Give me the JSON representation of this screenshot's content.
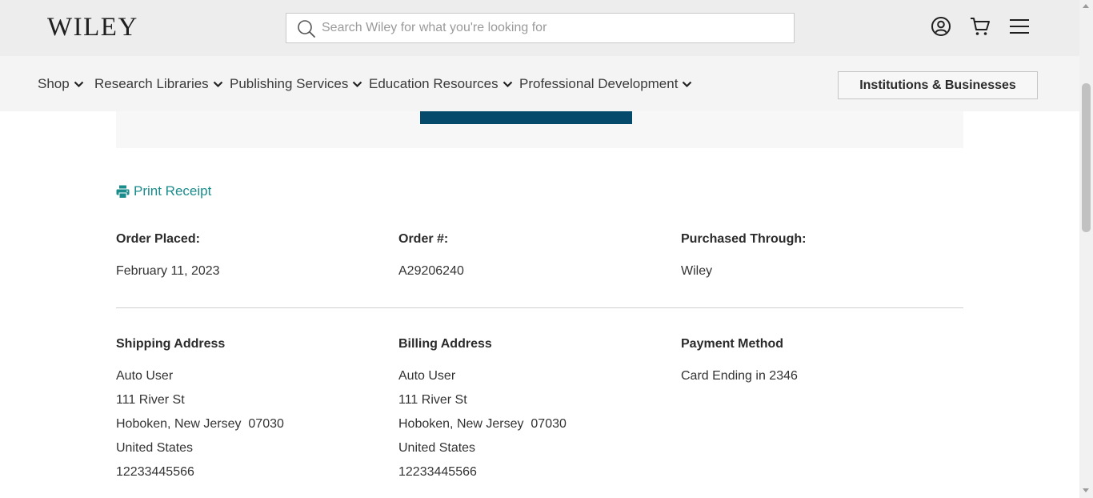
{
  "header": {
    "logo": "WILEY",
    "search_placeholder": "Search Wiley for what you're looking for",
    "icons": [
      "account-icon",
      "cart-icon",
      "menu-icon"
    ]
  },
  "nav": {
    "items": [
      {
        "label": "Shop"
      },
      {
        "label": "Research Libraries"
      },
      {
        "label": "Publishing Services"
      },
      {
        "label": "Education Resources"
      },
      {
        "label": "Professional Development"
      }
    ],
    "institutions_label": "Institutions & Businesses"
  },
  "order": {
    "print_label": "Print Receipt",
    "placed_label": "Order Placed:",
    "placed_value": "February 11, 2023",
    "number_label": "Order #:",
    "number_value": "A29206240",
    "through_label": "Purchased Through:",
    "through_value": "Wiley"
  },
  "shipping": {
    "label": "Shipping Address",
    "name": "Auto User",
    "street": "111 River St",
    "city_line": "Hoboken, New Jersey  07030",
    "country": "United States",
    "phone": "12233445566"
  },
  "billing": {
    "label": "Billing Address",
    "name": "Auto User",
    "street": "111 River St",
    "city_line": "Hoboken, New Jersey  07030",
    "country": "United States",
    "phone": "12233445566"
  },
  "payment": {
    "label": "Payment Method",
    "card": "Card Ending in 2346"
  },
  "colors": {
    "accent_teal": "#1a8c8c",
    "brand_dark_blue": "#054a6b",
    "header_bg": "#ededed",
    "nav_bg": "#f4f4f4"
  }
}
